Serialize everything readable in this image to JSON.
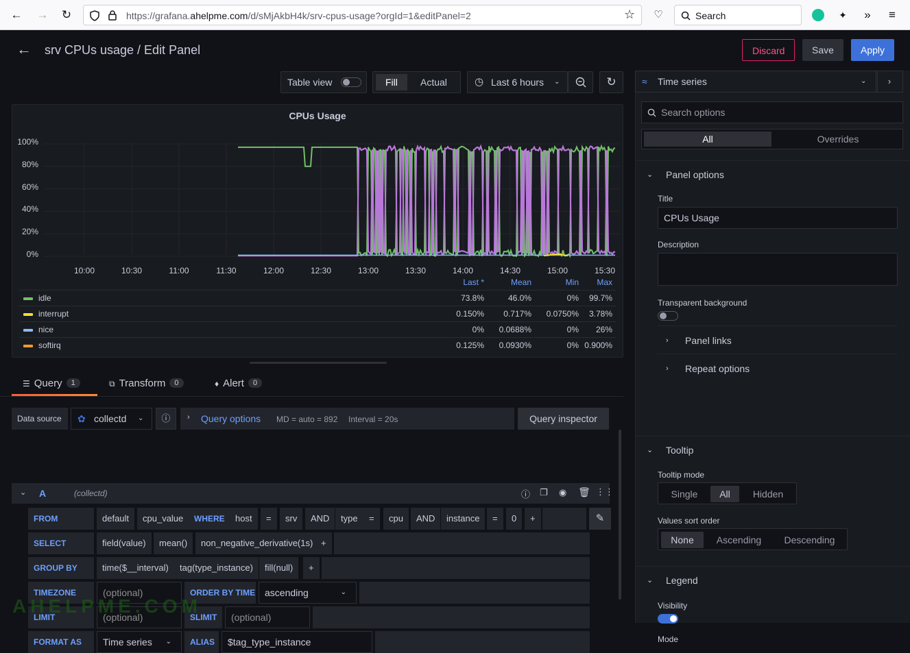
{
  "browser": {
    "url_prefix": "https://grafana.",
    "url_domain": "ahelpme.com",
    "url_suffix": "/d/sMjAkbH4k/srv-cpus-usage?orgId=1&editPanel=2",
    "search_label": "Search"
  },
  "header": {
    "title": "srv CPUs usage / Edit Panel",
    "discard": "Discard",
    "save": "Save",
    "apply": "Apply"
  },
  "toolbar": {
    "table_view": "Table view",
    "fill": "Fill",
    "actual": "Actual",
    "time_range": "Last 6 hours",
    "viz_type": "Time series"
  },
  "chart_data": {
    "type": "line",
    "title": "CPUs Usage",
    "yticks": [
      "100%",
      "80%",
      "60%",
      "40%",
      "20%",
      "0%"
    ],
    "xticks": [
      "10:00",
      "10:30",
      "11:00",
      "11:30",
      "12:00",
      "12:30",
      "13:00",
      "13:30",
      "14:00",
      "14:30",
      "15:00",
      "15:30"
    ],
    "ylim": [
      0,
      100
    ],
    "legend_headers": [
      "Last *",
      "Mean",
      "Min",
      "Max"
    ],
    "series": [
      {
        "name": "idle",
        "color": "#73bf69",
        "last": "73.8%",
        "mean": "46.0%",
        "min": "0%",
        "max": "99.7%"
      },
      {
        "name": "interrupt",
        "color": "#fade2a",
        "last": "0.150%",
        "mean": "0.717%",
        "min": "0.0750%",
        "max": "3.78%"
      },
      {
        "name": "nice",
        "color": "#8ab8ff",
        "last": "0%",
        "mean": "0.0688%",
        "min": "0%",
        "max": "26%"
      },
      {
        "name": "softirq",
        "color": "#ff9830",
        "last": "0.125%",
        "mean": "0.0930%",
        "min": "0%",
        "max": "0.900%"
      }
    ],
    "hidden_series_color": "#b877d9"
  },
  "tabs": {
    "query": "Query",
    "query_count": "1",
    "transform": "Transform",
    "transform_count": "0",
    "alert": "Alert",
    "alert_count": "0"
  },
  "query": {
    "data_source_label": "Data source",
    "data_source": "collectd",
    "query_options": "Query options",
    "md": "MD = auto = 892",
    "interval": "Interval = 20s",
    "inspector": "Query inspector",
    "ref": "A",
    "ref_source": "(collectd)",
    "from_kw": "FROM",
    "from": [
      "default",
      "cpu_value"
    ],
    "where_kw": "WHERE",
    "where": [
      "host",
      "=",
      "srv",
      "AND",
      "type",
      "=",
      "cpu",
      "AND",
      "instance",
      "=",
      "0",
      "+"
    ],
    "select_kw": "SELECT",
    "select": [
      "field(value)",
      "mean()",
      "non_negative_derivative(1s)",
      "+"
    ],
    "groupby_kw": "GROUP BY",
    "groupby": [
      "time($__interval)",
      "tag(type_instance)",
      "fill(null)",
      "+"
    ],
    "timezone_kw": "TIMEZONE",
    "optional": "(optional)",
    "orderby_kw": "ORDER BY TIME",
    "orderby": "ascending",
    "limit_kw": "LIMIT",
    "slimit_kw": "SLIMIT",
    "format_kw": "FORMAT AS",
    "format": "Time series",
    "alias_kw": "ALIAS",
    "alias": "$tag_type_instance"
  },
  "side": {
    "search_placeholder": "Search options",
    "all": "All",
    "overrides": "Overrides",
    "panel_options": "Panel options",
    "title_label": "Title",
    "title_value": "CPUs Usage",
    "description_label": "Description",
    "transparent_label": "Transparent background",
    "panel_links": "Panel links",
    "repeat_options": "Repeat options",
    "tooltip": "Tooltip",
    "tooltip_mode_label": "Tooltip mode",
    "tooltip_modes": [
      "Single",
      "All",
      "Hidden"
    ],
    "sort_label": "Values sort order",
    "sort_modes": [
      "None",
      "Ascending",
      "Descending"
    ],
    "legend": "Legend",
    "visibility_label": "Visibility",
    "mode_label": "Mode"
  },
  "watermark": "AHELPME.COM"
}
